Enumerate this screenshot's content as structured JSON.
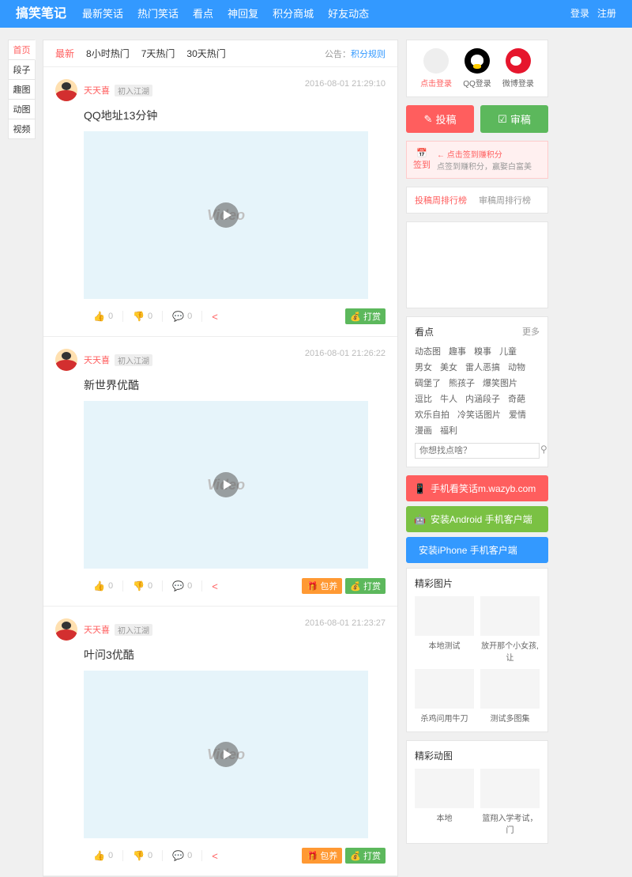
{
  "header": {
    "logo": "搞笑笔记",
    "nav": [
      "最新笑话",
      "热门笑话",
      "看点",
      "神回复",
      "积分商城",
      "好友动态"
    ],
    "login": "登录",
    "register": "注册"
  },
  "sidenav": [
    "首页",
    "段子",
    "趣图",
    "动图",
    "视频"
  ],
  "tabs": [
    "最新",
    "8小时热门",
    "7天热门",
    "30天热门"
  ],
  "notice": {
    "label": "公告：",
    "link": "积分规则"
  },
  "posts": [
    {
      "user": "天天喜",
      "badge": "初入江湖",
      "time": "2016-08-01 21:29:10",
      "title": "QQ地址13分钟",
      "like": "0",
      "dislike": "0",
      "comment": "0",
      "buttons": [
        "打赏"
      ]
    },
    {
      "user": "天天喜",
      "badge": "初入江湖",
      "time": "2016-08-01 21:26:22",
      "title": "新世界优酷",
      "like": "0",
      "dislike": "0",
      "comment": "0",
      "buttons": [
        "包养",
        "打赏"
      ]
    },
    {
      "user": "天天喜",
      "badge": "初入江湖",
      "time": "2016-08-01 21:23:27",
      "title": "叶问3优酷",
      "like": "0",
      "dislike": "0",
      "comment": "0",
      "buttons": [
        "包养",
        "打赏"
      ]
    }
  ],
  "login_box": {
    "click": "点击登录",
    "qq": "QQ登录",
    "weibo": "微博登录"
  },
  "buttons": {
    "submit": "投稿",
    "review": "审稿"
  },
  "checkin": {
    "title": "签到",
    "link": "点击签到赚积分",
    "desc": "点签到赚积分，赢娶白富美"
  },
  "ranks": [
    "投稿周排行榜",
    "审稿周排行榜"
  ],
  "kandian": {
    "title": "看点",
    "more": "更多",
    "tags": [
      "动态图",
      "趣事",
      "糗事",
      "儿童",
      "男女",
      "美女",
      "雷人恶搞",
      "动物",
      "碉堡了",
      "熊孩子",
      "爆笑图片",
      "逗比",
      "牛人",
      "内涵段子",
      "奇葩",
      "欢乐自拍",
      "冷笑话图片",
      "爱情",
      "漫画",
      "福利"
    ],
    "placeholder": "你想找点啥？"
  },
  "apps": {
    "mobile": "手机看笑话m.wazyb.com",
    "android": "安装Android 手机客户端",
    "iphone": "安装iPhone 手机客户端"
  },
  "pic_box": {
    "title": "精彩图片",
    "items": [
      "本地测试",
      "放开那个小女孩,让",
      "杀鸡问用牛刀",
      "测试多图集"
    ]
  },
  "gif_box": {
    "title": "精彩动图",
    "items": [
      "本地",
      "篮翔入学考试，门"
    ]
  }
}
